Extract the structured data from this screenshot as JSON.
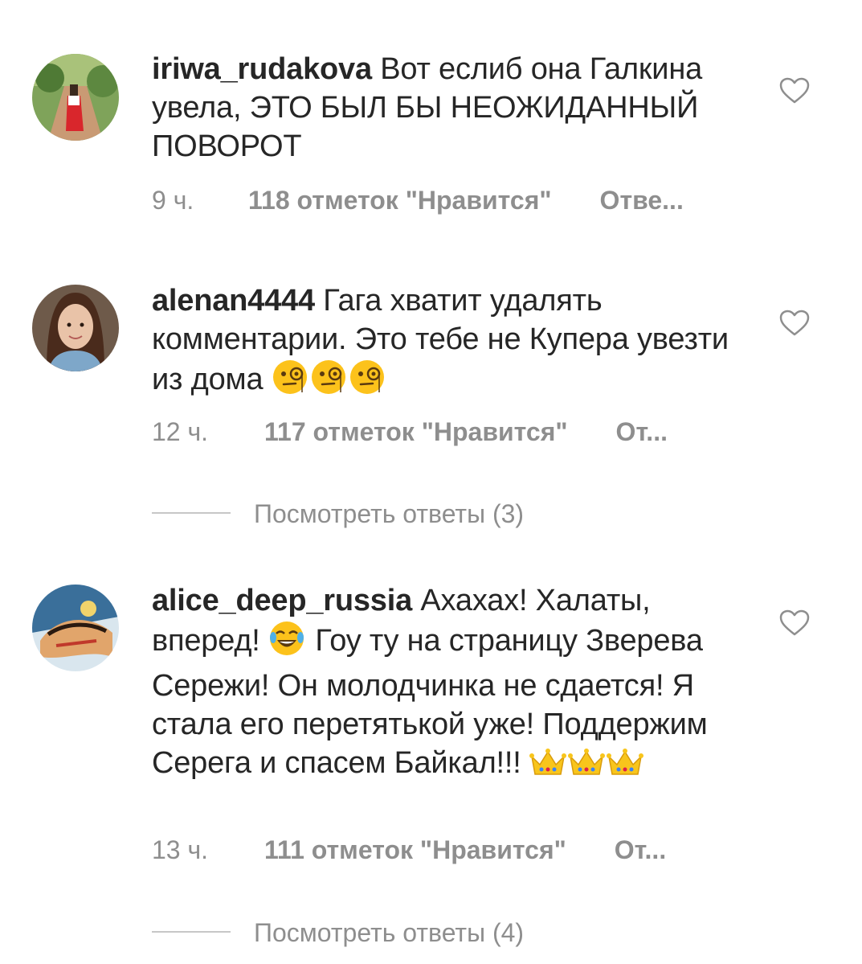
{
  "colors": {
    "text": "#262626",
    "secondary": "#8e8e8e",
    "divider": "#c7c7c7",
    "background": "#ffffff"
  },
  "comments": [
    {
      "username": "iriwa_rudakova",
      "text": " Вот еслиб она Галкина увела,  ЭТО БЫЛ БЫ НЕОЖИДАННЫЙ ПОВОРОТ",
      "time": "9 ч.",
      "likes": "118 отметок \"Нравится\"",
      "reply": "Отве...",
      "avatar_icon": "avatar-photo-icon",
      "like_icon": "heart-outline-icon"
    },
    {
      "username": "alenan4444",
      "text": " Гага хватит удалять комментарии. Это тебе не Купера увезти из дома ",
      "emojis": [
        "face-with-monocle",
        "face-with-monocle",
        "face-with-monocle"
      ],
      "time": "12 ч.",
      "likes": "117 отметок \"Нравится\"",
      "reply": "От...",
      "view_replies": "Посмотреть ответы (3)",
      "avatar_icon": "avatar-photo-icon",
      "like_icon": "heart-outline-icon"
    },
    {
      "username": "alice_deep_russia",
      "text_part1": " Ахахах! Халаты, вперед! ",
      "text_part2": " Гоу ту на страницу Зверева Сережи! Он молодчинка не сдается! Я стала его перетятькой уже! Поддержим Серега и спасем Байкал!!! ",
      "emojis": [
        "face-with-tears-of-joy",
        "crown",
        "crown",
        "crown"
      ],
      "time": "13 ч.",
      "likes": "111 отметок \"Нравится\"",
      "reply": "От...",
      "view_replies": "Посмотреть ответы (4)",
      "avatar_icon": "avatar-photo-icon",
      "like_icon": "heart-outline-icon"
    }
  ]
}
